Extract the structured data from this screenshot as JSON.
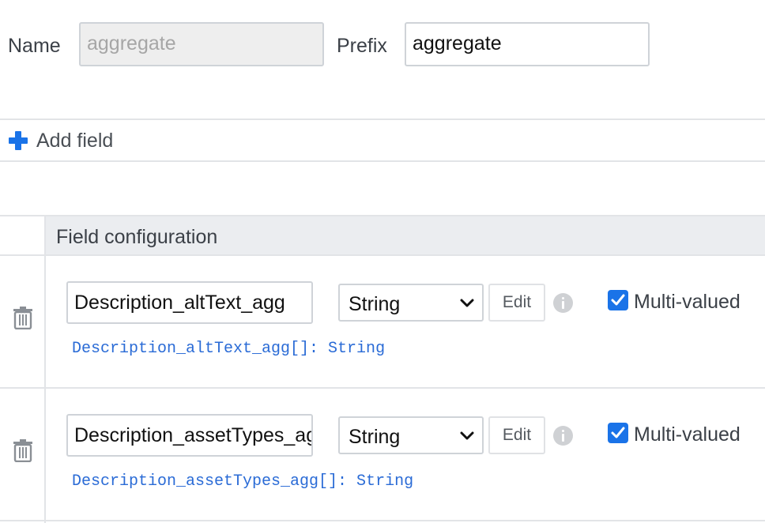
{
  "form": {
    "name_label": "Name",
    "name_value": "aggregate",
    "prefix_label": "Prefix",
    "prefix_value": "aggregate"
  },
  "toolbar": {
    "add_field_label": "Add field",
    "add_icon": "plus-icon"
  },
  "table": {
    "header": "Field configuration",
    "rows": [
      {
        "field_name": "Description_altText_agg",
        "type": "String",
        "edit_label": "Edit",
        "multi_valued_label": "Multi-valued",
        "multi_valued": true,
        "signature": "Description_altText_agg[]: String"
      },
      {
        "field_name": "Description_assetTypes_agg",
        "type": "String",
        "edit_label": "Edit",
        "multi_valued_label": "Multi-valued",
        "multi_valued": true,
        "signature": "Description_assetTypes_agg[]: String"
      }
    ]
  },
  "colors": {
    "accent": "#1a73e8",
    "signature": "#2a6bd6",
    "header_bg": "#ebedf0",
    "border": "#e2e4e7"
  }
}
